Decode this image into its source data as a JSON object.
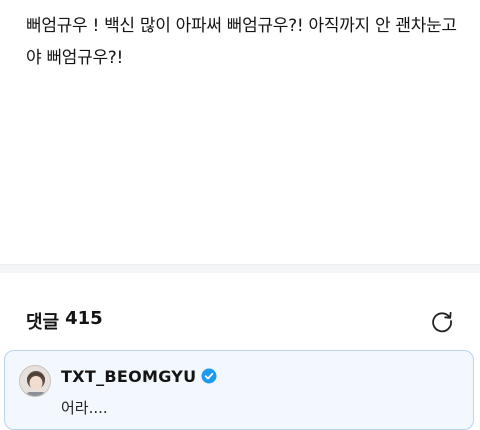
{
  "post": {
    "body": "뻐엄규우 ! 백신 많이 아파써 뻐엄규우?! 아직까지 안 괜차눈고야 뻐엄규우?!"
  },
  "comments": {
    "label": "댓글",
    "count": "415",
    "refresh_icon": "refresh-icon"
  },
  "comment": {
    "avatar_icon": "avatar",
    "author": "TXT_BEOMGYU",
    "verified_icon": "verified-badge-icon",
    "text": "어라....",
    "accent_color": "#1d9bf0"
  }
}
